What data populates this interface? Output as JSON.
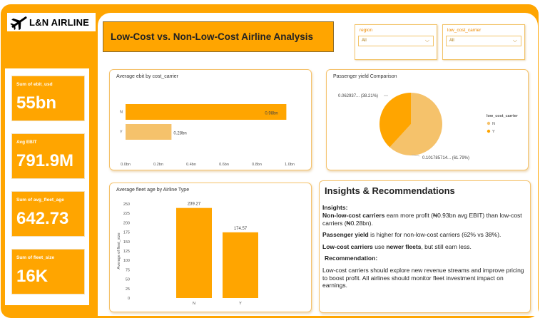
{
  "app": {
    "logo_text": "L&N AIRLINE",
    "title": "Low-Cost vs. Non-Low-Cost Airline Analysis"
  },
  "colors": {
    "accent": "#FFA500",
    "light_accent": "#F5C26B"
  },
  "kpis": [
    {
      "label": "Sum of ebit_usd",
      "value": "55bn"
    },
    {
      "label": "Avg EBIT",
      "value": "791.9M"
    },
    {
      "label": "Sum of avg_fleet_age",
      "value": "642.73"
    },
    {
      "label": "Sum of fleet_size",
      "value": "16K"
    }
  ],
  "slicers": [
    {
      "title": "region",
      "value": "All"
    },
    {
      "title": "low_cost_carrier",
      "value": "All"
    }
  ],
  "ebit_chart": {
    "title": "Average ebit by cost_carrier",
    "chart_data": {
      "type": "bar",
      "orientation": "horizontal",
      "categories": [
        "N",
        "Y"
      ],
      "values": [
        0.98,
        0.28
      ],
      "value_labels": [
        "0.98bn",
        "0.28bn"
      ],
      "xlim": [
        0,
        1.0
      ],
      "xticks": [
        "0.0bn",
        "0.2bn",
        "0.4bn",
        "0.6bn",
        "0.8bn",
        "1.0bn"
      ],
      "colors": [
        "#FFA500",
        "#F5C26B"
      ]
    }
  },
  "yield_chart": {
    "title": "Passenger yield Comparison",
    "legend_title": "low_cost_carrier",
    "chart_data": {
      "type": "pie",
      "categories": [
        "N",
        "Y"
      ],
      "values": [
        61.79,
        38.21
      ],
      "slice_labels": [
        "0.101785714... (61.79%)",
        "0.062937... (38.21%)"
      ],
      "colors": [
        "#F5C26B",
        "#FFA500"
      ],
      "legend": "right"
    }
  },
  "fleet_chart": {
    "title": "Average fleet age by Airline Type",
    "ylabel": "Average of fleet_size",
    "chart_data": {
      "type": "bar",
      "categories": [
        "N",
        "Y"
      ],
      "values": [
        239.27,
        174.57
      ],
      "value_labels": [
        "239.27",
        "174.57"
      ],
      "ylim": [
        0,
        250
      ],
      "yticks": [
        "0",
        "25",
        "50",
        "75",
        "100",
        "125",
        "150",
        "175",
        "200",
        "225",
        "250"
      ],
      "color": "#FFA500"
    }
  },
  "insights": {
    "title": "Insights & Recommendations",
    "insights_heading": "Insights:",
    "p1_bold": "Non-low-cost carriers",
    "p1_rest": " earn more profit (₦0.93bn avg EBIT) than low-cost carriers (₦0.28bn).",
    "p2_bold": "Passenger yield",
    "p2_rest": " is higher for non-low-cost carriers (62% vs 38%).",
    "p3_bold1": "Low-cost carriers",
    "p3_mid": " use ",
    "p3_bold2": "newer fleets",
    "p3_rest": ", but still earn less.",
    "rec_heading": "Recommendation:",
    "p4": "Low-cost carriers should explore new revenue streams and improve pricing to boost profit. All airlines should monitor fleet investment impact on earnings."
  }
}
